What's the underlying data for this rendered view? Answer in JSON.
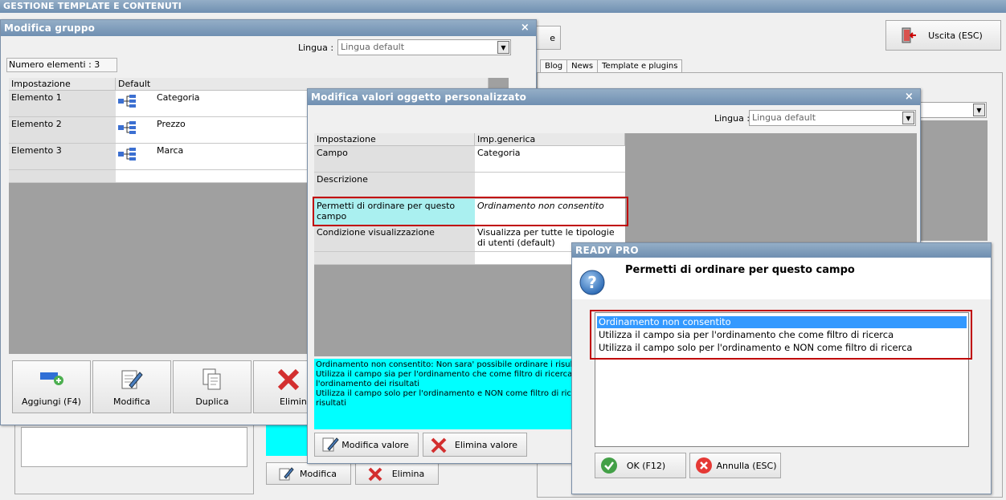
{
  "app_title": "GESTIONE TEMPLATE E CONTENUTI",
  "main": {
    "exit_label": "Uscita (ESC)",
    "partial_button": "e",
    "tabs": [
      "Blog",
      "News",
      "Template e plugins"
    ],
    "modifica_label": "Modifica",
    "elimina_label": "Elimina"
  },
  "group_window": {
    "title": "Modifica gruppo",
    "lingua_label": "Lingua :",
    "lingua_value": "Lingua default",
    "count_label": "Numero elementi : 3",
    "columns": [
      "Impostazione",
      "Default"
    ],
    "rows": [
      {
        "name": "Elemento 1",
        "value": "Categoria"
      },
      {
        "name": "Elemento 2",
        "value": "Prezzo"
      },
      {
        "name": "Elemento 3",
        "value": "Marca"
      }
    ],
    "buttons": {
      "add": "Aggiungi (F4)",
      "edit": "Modifica",
      "duplicate": "Duplica",
      "delete": "Elimina"
    }
  },
  "obj_window": {
    "title": "Modifica valori oggetto personalizzato",
    "lingua_label": "Lingua :",
    "lingua_value": "Lingua default",
    "columns": [
      "Impostazione",
      "Imp.generica"
    ],
    "rows": [
      {
        "name": "Campo",
        "value": "Categoria"
      },
      {
        "name": "Descrizione",
        "value": ""
      },
      {
        "name": "Permetti di ordinare per questo campo",
        "value": "Ordinamento non consentito"
      },
      {
        "name": "Condizione visualizzazione",
        "value": "Visualizza per tutte le tipologie di utenti (default)"
      }
    ],
    "help_text": [
      "Ordinamento non consentito: Non sara' possibile ordinare i risultati",
      "Utilizza il campo sia per l'ordinamento che come filtro di ricerca: Il ca",
      "l'ordinamento dei risultati",
      "Utilizza il campo solo per l'ordinamento e NON come filtro di ricerca:",
      "risultati"
    ],
    "buttons": {
      "edit_value": "Modifica valore",
      "delete_value": "Elimina valore"
    }
  },
  "dialog": {
    "title": "READY PRO",
    "question": "Permetti di ordinare per questo campo",
    "options": [
      "Ordinamento non consentito",
      "Utilizza il campo sia per l'ordinamento che come filtro di ricerca",
      "Utilizza il campo solo per l'ordinamento e NON come filtro di ricerca"
    ],
    "ok_label": "OK (F12)",
    "cancel_label": "Annulla (ESC)"
  },
  "colors": {
    "selection": "#3399ff",
    "highlight_cyan": "#00ffff",
    "title_blue": "#7a98b8",
    "red_box": "#c00000"
  }
}
